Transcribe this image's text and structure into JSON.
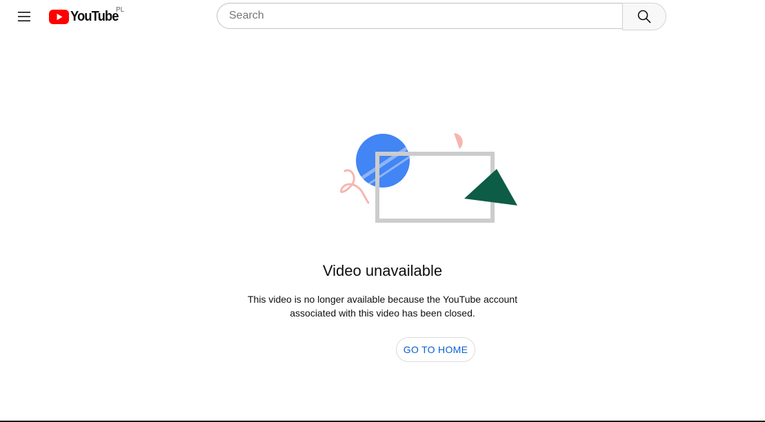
{
  "header": {
    "logo_text": "YouTube",
    "country_code": "PL",
    "search": {
      "placeholder": "Search",
      "value": ""
    },
    "icons": {
      "menu": "hamburger-menu-icon",
      "search": "search-icon",
      "logo": "youtube-play-icon"
    }
  },
  "error": {
    "title": "Video unavailable",
    "message_line1": "This video is no longer available because the YouTube account",
    "message_line2": "associated with this video has been closed.",
    "button_label": "GO TO HOME"
  },
  "colors": {
    "brand_red": "#ff0000",
    "link_blue": "#065fd4",
    "illustration_blue": "#4285f4",
    "illustration_green": "#0d5c46",
    "illustration_pink": "#f7b5b0",
    "illustration_frame": "#cccccc"
  }
}
